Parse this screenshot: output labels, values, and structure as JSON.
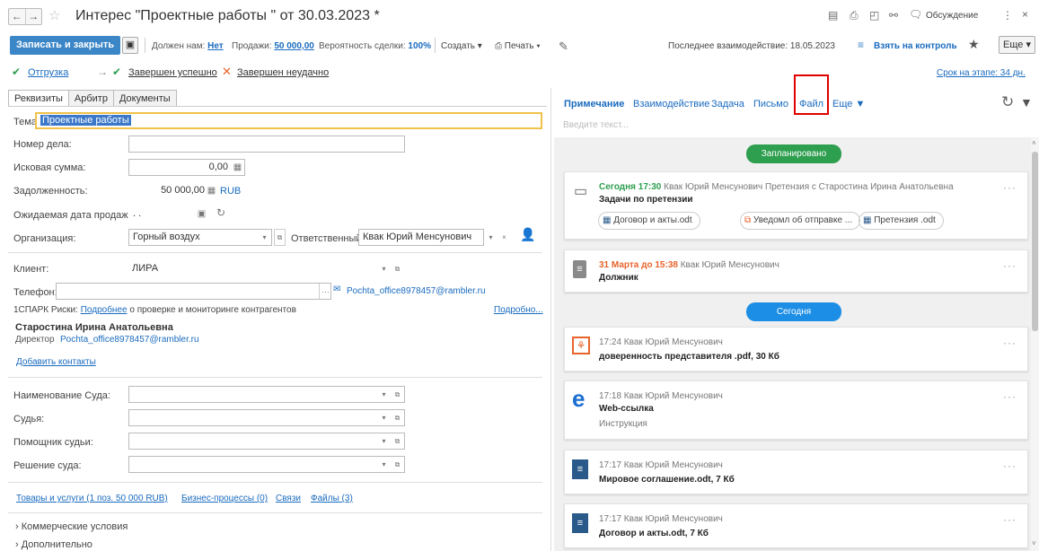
{
  "window": {
    "title": "Интерес \"Проектные работы \" от 30.03.2023 *",
    "discussion": "Обсуждение"
  },
  "toolbar": {
    "save_close": "Записать и закрыть",
    "owed_label": "Должен нам:",
    "owed_value": "Нет",
    "sales_label": "Продажи:",
    "sales_value": "50 000,00",
    "probability_label": "Вероятность сделки:",
    "probability_value": "100%",
    "create": "Создать",
    "print": "Печать",
    "last_interaction": "Последнее взаимодействие: 18.05.2023",
    "take_control": "Взять на контроль",
    "more": "Еще"
  },
  "status": {
    "shipment": "Отгрузка",
    "success": "Завершен успешно",
    "fail": "Завершен неудачно",
    "stage_time": "Срок на этапе: 34 дн."
  },
  "tabs": [
    "Реквизиты",
    "Арбитр",
    "Документы"
  ],
  "form": {
    "topic_label": "Тема:",
    "topic_value": "Проектные работы",
    "case_label": "Номер дела:",
    "claim_label": "Исковая сумма:",
    "claim_value": "0,00",
    "debt_label": "Задолженность:",
    "debt_value": "50 000,00",
    "currency": "RUB",
    "expected_date_label": "Ожидаемая дата продажи:",
    "expected_date_value": ". .",
    "org_label": "Организация:",
    "org_value": "Горный воздух",
    "resp_label": "Ответственный:",
    "resp_value": "Квак Юрий Менсунович",
    "client_label": "Клиент:",
    "client_value": "ЛИРА",
    "phone_label": "Телефон:",
    "email": "Pochta_office8978457@rambler.ru",
    "spark_prefix": "1СПАРК Риски:",
    "spark_link": "Подробнее",
    "spark_text": "о проверке и мониторинге контрагентов",
    "spark_more": "Подробно...",
    "contact_name": "Старостина Ирина Анатольевна",
    "contact_role": "Директор",
    "contact_email": "Pochta_office8978457@rambler.ru",
    "add_contacts": "Добавить контакты",
    "court_name_label": "Наименование Суда:",
    "judge_label": "Судья:",
    "assistant_label": "Помощник судьи:",
    "decision_label": "Решение суда:",
    "link_goods": "Товары и услуги (1 поз. 50 000 RUB)",
    "link_bp": "Бизнес-процессы (0)",
    "link_links": "Связи",
    "link_files": "Файлы (3)",
    "section_commercial": "Коммерческие условия",
    "section_additional": "Дополнительно"
  },
  "right": {
    "tabs": [
      "Примечание",
      "Взаимодействие",
      "Задача",
      "Письмо",
      "Файл",
      "Еще"
    ],
    "input_placeholder": "Введите текст...",
    "planned": "Запланировано",
    "today": "Сегодня",
    "cards": [
      {
        "time_accent": "Сегодня 17:30",
        "time_rest": "Квак Юрий Менсунович Претензия с Старостина Ирина Анатольевна",
        "title": "Задачи по претензии"
      },
      {
        "time_accent": "31 Марта до 15:38",
        "time_rest": "Квак Юрий Менсунович",
        "title": "Должник"
      },
      {
        "time": "17:24 Квак Юрий Менсунович",
        "title": "доверенность представителя .pdf, 30 Кб"
      },
      {
        "time": "17:18 Квак Юрий Менсунович",
        "title": "Web-ссылка",
        "sub": "Инструкция"
      },
      {
        "time": "17:17 Квак Юрий Менсунович",
        "title": "Мировое соглашение.odt, 7 Кб"
      },
      {
        "time": "17:17 Квак Юрий Менсунович",
        "title": "Договор и акты.odt, 7 Кб"
      }
    ],
    "chips": [
      "Договор и акты.odt",
      "Уведомл об отправке ...",
      "Претензия .odt"
    ]
  },
  "colors": {
    "accent": "#3b86c7",
    "green": "#2e9e4f",
    "blue_pill": "#1c8ee6",
    "orange": "#e8632b",
    "highlight": "#e00000"
  }
}
